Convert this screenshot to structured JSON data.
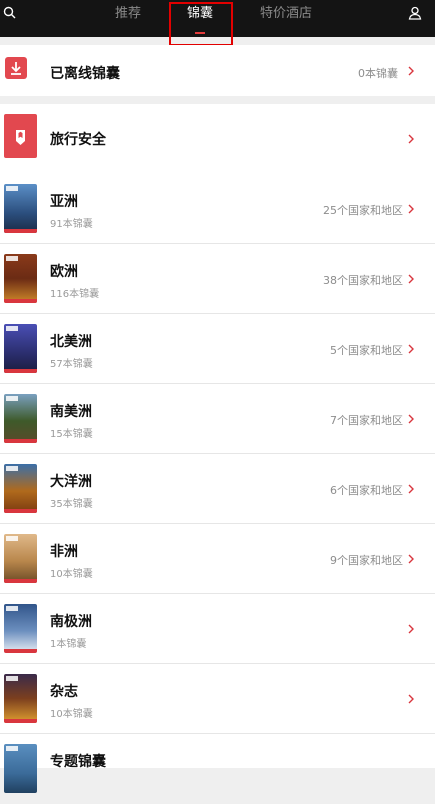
{
  "topbar": {
    "tabs": [
      {
        "label": "推荐"
      },
      {
        "label": "锦囊"
      },
      {
        "label": "特价酒店"
      }
    ],
    "active_tab_index": 1,
    "icons": {
      "left": "search-icon",
      "right": "user-icon"
    },
    "colors": {
      "background": "#141414",
      "active_indicator": "#e33b3b",
      "highlight_box": "#e20000"
    }
  },
  "offline": {
    "title": "已离线锦囊",
    "count": "0本锦囊",
    "icon": "download-icon"
  },
  "safety": {
    "title": "旅行安全",
    "icon": "shield-icon"
  },
  "regions": [
    {
      "name": "亚洲",
      "guides": "91本锦囊",
      "countries": "25个国家和地区",
      "thumb_color": "#2b4e7d"
    },
    {
      "name": "欧洲",
      "guides": "116本锦囊",
      "countries": "38个国家和地区",
      "thumb_color": "#6b2b14"
    },
    {
      "name": "北美洲",
      "guides": "57本锦囊",
      "countries": "5个国家和地区",
      "thumb_color": "#2b2e6e"
    },
    {
      "name": "南美洲",
      "guides": "15本锦囊",
      "countries": "7个国家和地区",
      "thumb_color": "#3e5a2a"
    },
    {
      "name": "大洋洲",
      "guides": "35本锦囊",
      "countries": "6个国家和地区",
      "thumb_color": "#b06a1c"
    },
    {
      "name": "非洲",
      "guides": "10本锦囊",
      "countries": "9个国家和地区",
      "thumb_color": "#b9874c"
    },
    {
      "name": "南极洲",
      "guides": "1本锦囊",
      "countries": "",
      "thumb_color": "#31558a"
    },
    {
      "name": "杂志",
      "guides": "10本锦囊",
      "countries": "",
      "thumb_color": "#7c3f1e"
    },
    {
      "name": "专题锦囊",
      "guides": "",
      "countries": "",
      "thumb_color": "#3b6b99"
    }
  ],
  "accent": "#e2484f"
}
